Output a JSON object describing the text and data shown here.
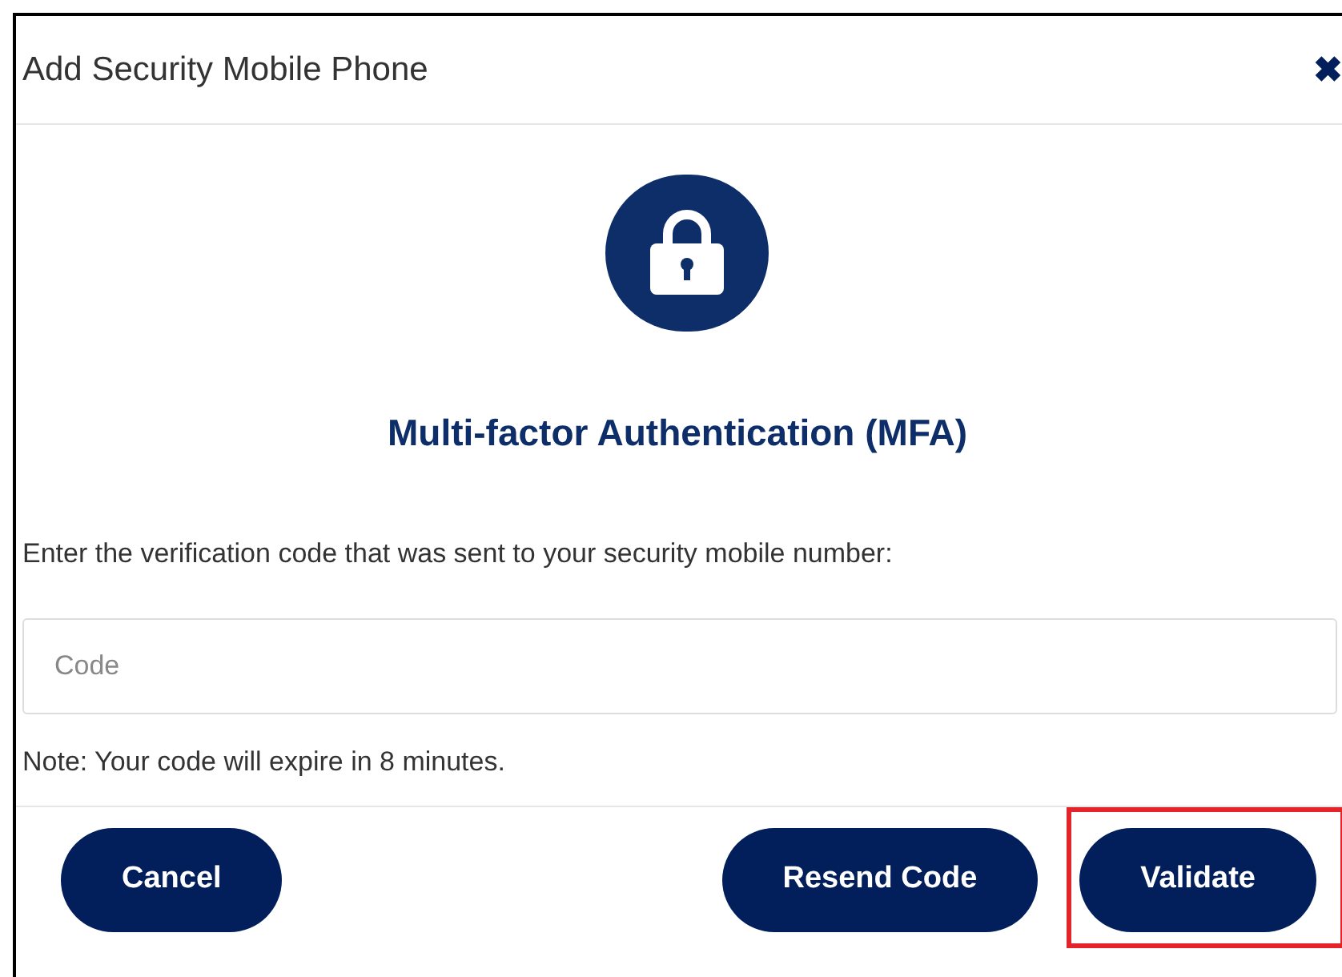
{
  "dialog": {
    "title": "Add Security Mobile Phone",
    "close": "✖"
  },
  "heading": "Multi-factor Authentication (MFA)",
  "instruction": "Enter the verification code that was sent to your security mobile number:",
  "code_field": {
    "placeholder": "Code"
  },
  "note": "Note: Your code will expire in 8 minutes.",
  "buttons": [
    {
      "label": "Cancel",
      "highlighted": false
    },
    {
      "label": "Resend Code",
      "highlighted": false
    },
    {
      "label": "Validate",
      "highlighted": true
    }
  ]
}
